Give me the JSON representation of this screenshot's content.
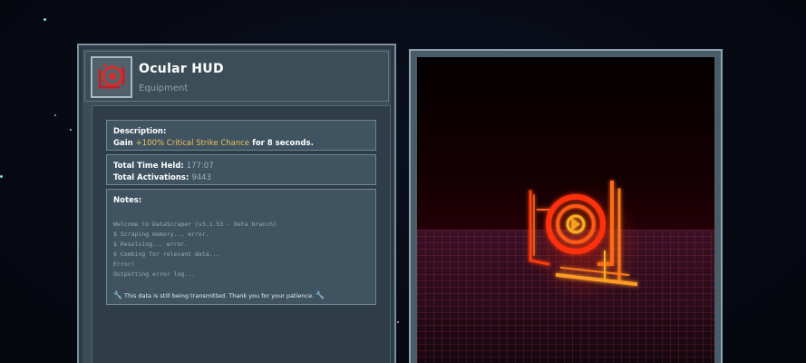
{
  "item": {
    "title": "Ocular HUD",
    "category": "Equipment",
    "icon": "ocular-hud-icon"
  },
  "description": {
    "label": "Description:",
    "text_prefix": "Gain ",
    "highlight": "+100% Critical Strike Chance",
    "text_suffix": " for 8 seconds."
  },
  "stats": {
    "time_held_label": "Total Time Held:",
    "time_held_value": "177:07",
    "activations_label": "Total Activations:",
    "activations_value": "9443"
  },
  "notes": {
    "label": "Notes:",
    "log": "Welcome to DataScraper (v3.1.53 - beta branch)\n$ Scraping memory... error.\n$ Resolving... error.\n$ Combing for relevant data...\nError!\nOutputting error log...",
    "footer": "This data is still being transmitted. Thank you for your patience."
  },
  "colors": {
    "highlight": "#f0c35a",
    "model_glow": "#ff3a10"
  }
}
